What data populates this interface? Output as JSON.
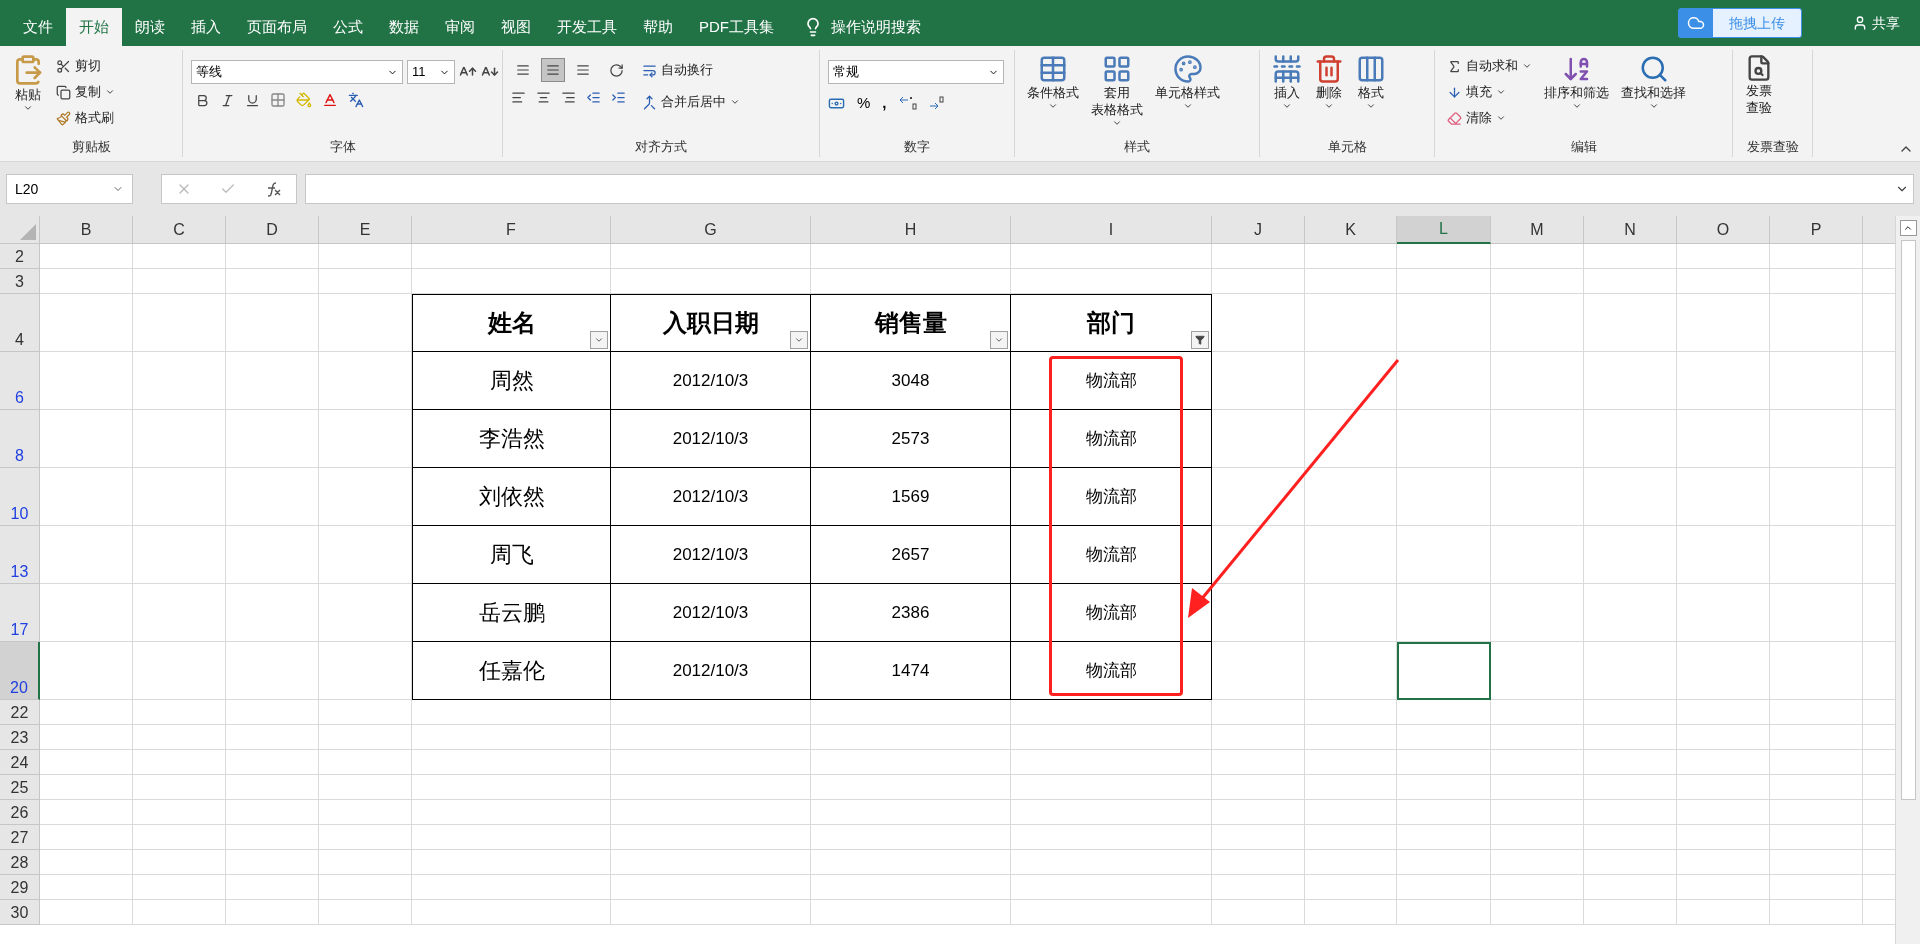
{
  "menu_tabs": [
    {
      "label": "文件",
      "selected": false
    },
    {
      "label": "开始",
      "selected": true
    },
    {
      "label": "朗读",
      "selected": false
    },
    {
      "label": "插入",
      "selected": false
    },
    {
      "label": "页面布局",
      "selected": false
    },
    {
      "label": "公式",
      "selected": false
    },
    {
      "label": "数据",
      "selected": false
    },
    {
      "label": "审阅",
      "selected": false
    },
    {
      "label": "视图",
      "selected": false
    },
    {
      "label": "开发工具",
      "selected": false
    },
    {
      "label": "帮助",
      "selected": false
    },
    {
      "label": "PDF工具集",
      "selected": false
    }
  ],
  "tell_me": "操作说明搜索",
  "upload_button": "拖拽上传",
  "share": "共享",
  "ribbon": [
    {
      "kind": "clipboard",
      "label": "剪贴板",
      "paste": "粘贴",
      "cut": "剪切",
      "copy": "复制",
      "format_painter": "格式刷"
    },
    {
      "kind": "font",
      "label": "字体",
      "font": "等线",
      "size": "11"
    },
    {
      "kind": "alignment",
      "label": "对齐方式",
      "valign_buttons": [
        {
          "selected": false
        },
        {
          "selected": true
        },
        {
          "selected": false
        }
      ],
      "wrap": "自动换行",
      "merge": "合并后居中"
    },
    {
      "kind": "number",
      "label": "数字",
      "format": "常规",
      "percent": "%",
      "comma": ","
    },
    {
      "kind": "styles",
      "label": "样式",
      "buttons": [
        [
          "条件格式"
        ],
        [
          "套用",
          "表格格式"
        ],
        [
          "单元格样式"
        ]
      ]
    },
    {
      "kind": "cells",
      "label": "单元格",
      "buttons": [
        "插入",
        "删除",
        "格式"
      ]
    },
    {
      "kind": "editing",
      "label": "编辑",
      "autosum": "自动求和",
      "fill": "填充",
      "clear": "清除",
      "sort": "排序和筛选",
      "find": "查找和选择"
    },
    {
      "kind": "invoice",
      "label": "发票查验",
      "button": [
        "发票",
        "查验"
      ]
    }
  ],
  "name_box": "L20",
  "sheet": {
    "columns": [
      {
        "label": "B",
        "selected": false
      },
      {
        "label": "C",
        "selected": false
      },
      {
        "label": "D",
        "selected": false
      },
      {
        "label": "E",
        "selected": false
      },
      {
        "label": "F",
        "selected": false
      },
      {
        "label": "G",
        "selected": false
      },
      {
        "label": "H",
        "selected": false
      },
      {
        "label": "I",
        "selected": false
      },
      {
        "label": "J",
        "selected": false
      },
      {
        "label": "K",
        "selected": false
      },
      {
        "label": "L",
        "selected": true
      },
      {
        "label": "M",
        "selected": false
      },
      {
        "label": "N",
        "selected": false
      },
      {
        "label": "O",
        "selected": false
      },
      {
        "label": "P",
        "selected": false
      }
    ],
    "rows": [
      {
        "label": "2",
        "filtered": false,
        "selected": false
      },
      {
        "label": "3",
        "filtered": false,
        "selected": false
      },
      {
        "label": "4",
        "filtered": false,
        "selected": false
      },
      {
        "label": "6",
        "filtered": true,
        "selected": false
      },
      {
        "label": "8",
        "filtered": true,
        "selected": false
      },
      {
        "label": "10",
        "filtered": true,
        "selected": false
      },
      {
        "label": "13",
        "filtered": true,
        "selected": false
      },
      {
        "label": "17",
        "filtered": true,
        "selected": false
      },
      {
        "label": "20",
        "filtered": true,
        "selected": true
      },
      {
        "label": "22",
        "filtered": false,
        "selected": false
      },
      {
        "label": "23",
        "filtered": false,
        "selected": false
      },
      {
        "label": "24",
        "filtered": false,
        "selected": false
      },
      {
        "label": "25",
        "filtered": false,
        "selected": false
      },
      {
        "label": "26",
        "filtered": false,
        "selected": false
      },
      {
        "label": "27",
        "filtered": false,
        "selected": false
      },
      {
        "label": "28",
        "filtered": false,
        "selected": false
      },
      {
        "label": "29",
        "filtered": false,
        "selected": false
      },
      {
        "label": "30",
        "filtered": false,
        "selected": false
      }
    ]
  },
  "annotation": {
    "kind": "box_with_arrow"
  },
  "table": {
    "columns": [
      {
        "label": "姓名",
        "filter_applied": false
      },
      {
        "label": "入职日期",
        "filter_applied": false
      },
      {
        "label": "销售量",
        "filter_applied": false
      },
      {
        "label": "部门",
        "filter_applied": true
      }
    ],
    "rows": [
      [
        "周然",
        "2012/10/3",
        "3048",
        "物流部"
      ],
      [
        "李浩然",
        "2012/10/3",
        "2573",
        "物流部"
      ],
      [
        "刘依然",
        "2012/10/3",
        "1569",
        "物流部"
      ],
      [
        "周飞",
        "2012/10/3",
        "2657",
        "物流部"
      ],
      [
        "岳云鹏",
        "2012/10/3",
        "2386",
        "物流部"
      ],
      [
        "任嘉伦",
        "2012/10/3",
        "1474",
        "物流部"
      ]
    ]
  }
}
